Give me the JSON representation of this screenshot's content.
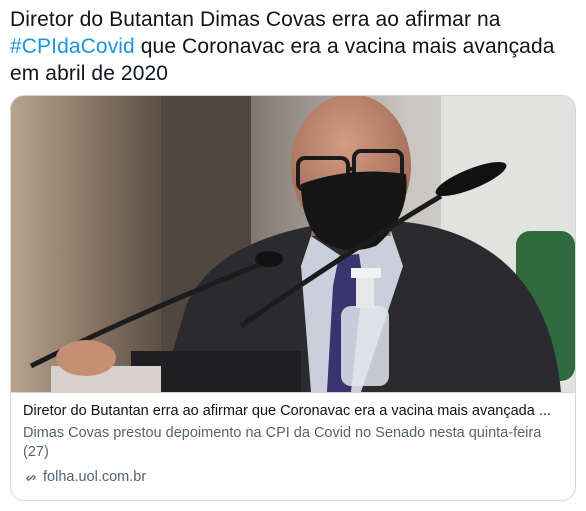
{
  "tweet": {
    "text_before": "Diretor do Butantan Dimas Covas erra ao afirmar na ",
    "hashtag": "#CPIdaCovid",
    "text_after": " que Coronavac era a vacina mais avançada em abril de 2020"
  },
  "card": {
    "image_icon": "photo-of-man-at-senate-microphone",
    "title": "Diretor do Butantan erra ao afirmar que Coronavac era a vacina mais avançada ...",
    "description": "Dimas Covas prestou depoimento na CPI da Covid no Senado nesta quinta-feira (27)",
    "domain": "folha.uol.com.br",
    "domain_icon": "link-icon"
  },
  "colors": {
    "hashtag": "#1b95e0",
    "text": "#0f1419",
    "secondary": "#536471",
    "border": "#cfd9de"
  }
}
